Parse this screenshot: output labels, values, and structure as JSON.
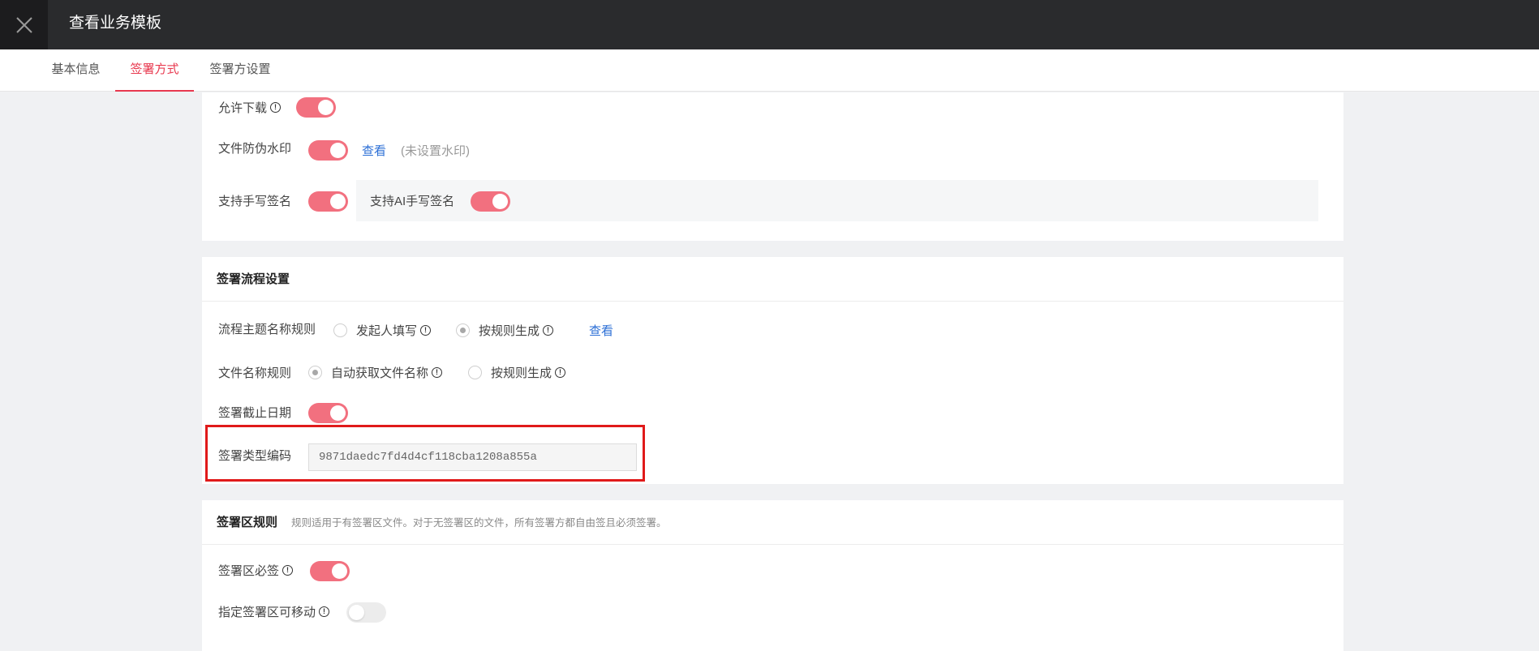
{
  "header": {
    "title": "查看业务模板"
  },
  "tabs": [
    {
      "label": "基本信息"
    },
    {
      "label": "签署方式"
    },
    {
      "label": "签署方设置"
    }
  ],
  "download_settings": {
    "allow_download_label": "允许下载",
    "allow_download_on": true,
    "watermark_label": "文件防伪水印",
    "watermark_on": true,
    "watermark_link": "查看",
    "watermark_status": "(未设置水印)",
    "handwriting_label": "支持手写签名",
    "handwriting_on": true,
    "ai_handwriting_label": "支持AI手写签名",
    "ai_handwriting_on": true
  },
  "flow_settings": {
    "title": "签署流程设置",
    "subject_rule_label": "流程主题名称规则",
    "subject_options": [
      {
        "label": "发起人填写",
        "checked": false
      },
      {
        "label": "按规则生成",
        "checked": true
      }
    ],
    "subject_link": "查看",
    "filename_rule_label": "文件名称规则",
    "filename_options": [
      {
        "label": "自动获取文件名称",
        "checked": true
      },
      {
        "label": "按规则生成",
        "checked": false
      }
    ],
    "deadline_label": "签署截止日期",
    "deadline_on": true,
    "type_code_label": "签署类型编码",
    "type_code_value": "9871daedc7fd4d4cf118cba1208a855a"
  },
  "area_rules": {
    "title": "签署区规则",
    "subtitle": "规则适用于有签署区文件。对于无签署区的文件，所有签署方都自由签且必须签署。",
    "required_label": "签署区必签",
    "required_on": true,
    "movable_label": "指定签署区可移动",
    "movable_on": false
  },
  "colors": {
    "accent": "#e8394f",
    "switch_on": "#f2707f",
    "link": "#2c6fd6",
    "highlight": "#e01a1a",
    "topbar": "#2a2b2d"
  },
  "icons": [
    "close-icon",
    "info-icon"
  ]
}
